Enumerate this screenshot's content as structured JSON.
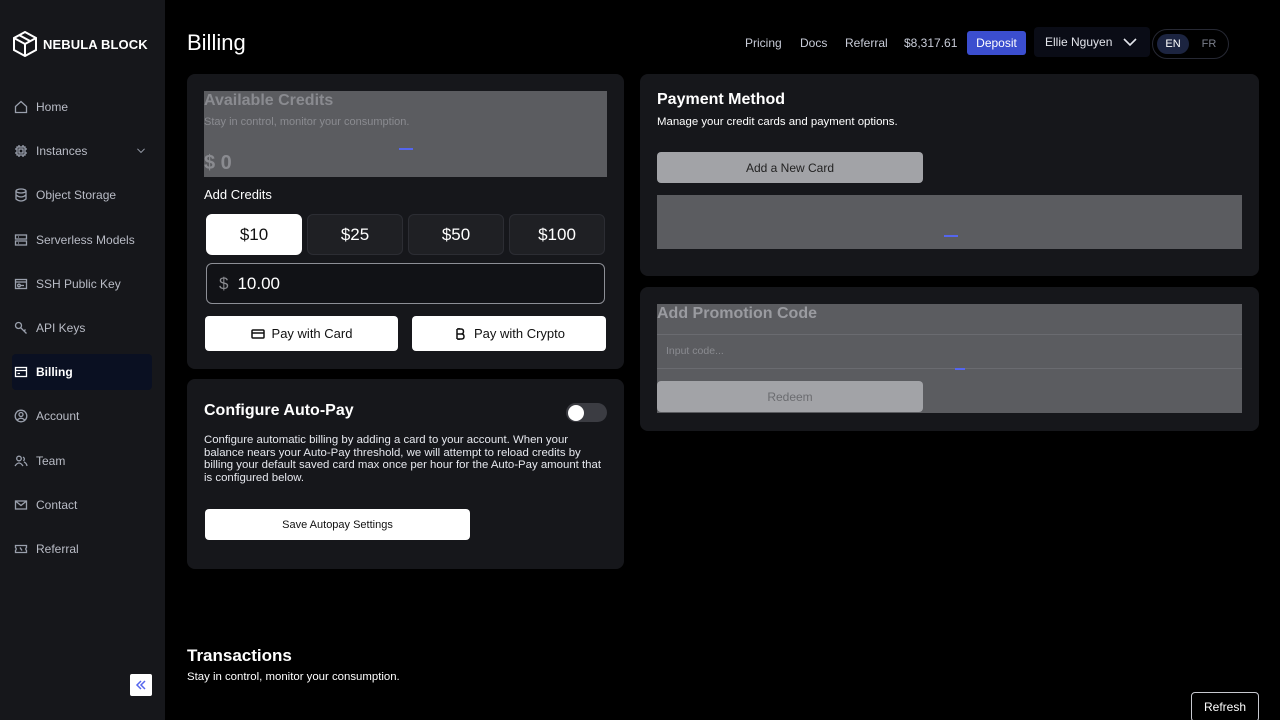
{
  "brand": {
    "name": "NEBULA BLOCK"
  },
  "sidebar": {
    "items": [
      {
        "label": "Home",
        "icon": "home-icon"
      },
      {
        "label": "Instances",
        "icon": "cpu-icon"
      },
      {
        "label": "Object Storage",
        "icon": "database-icon"
      },
      {
        "label": "Serverless Models",
        "icon": "server-icon"
      },
      {
        "label": "SSH Public Key",
        "icon": "key-box-icon"
      },
      {
        "label": "API Keys",
        "icon": "key-icon"
      },
      {
        "label": "Billing",
        "icon": "billing-icon"
      },
      {
        "label": "Account",
        "icon": "user-circle-icon"
      },
      {
        "label": "Team",
        "icon": "team-icon"
      },
      {
        "label": "Contact",
        "icon": "mail-icon"
      },
      {
        "label": "Referral",
        "icon": "ticket-icon"
      }
    ],
    "active": "Billing"
  },
  "header": {
    "title": "Billing",
    "links": [
      "Pricing",
      "Docs",
      "Referral"
    ],
    "balance": "$8,317.61",
    "deposit_label": "Deposit",
    "user_name": "Ellie Nguyen",
    "languages": [
      "EN",
      "FR"
    ],
    "active_language": "EN"
  },
  "credits": {
    "title": "Available Credits",
    "subtitle": "Stay in control, monitor your consumption.",
    "amount": "$ 0",
    "add_label": "Add Credits",
    "presets": [
      "$10",
      "$25",
      "$50",
      "$100"
    ],
    "selected_preset": "$10",
    "currency_symbol": "$",
    "input_value": "10.00",
    "pay_card_label": "Pay with Card",
    "pay_crypto_label": "Pay with Crypto"
  },
  "autopay": {
    "title": "Configure Auto-Pay",
    "enabled": false,
    "description": "Configure automatic billing by adding a card to your account. When your balance nears your Auto-Pay threshold, we will attempt to reload credits by billing your default saved card max once per hour for the Auto-Pay amount that is configured below.",
    "save_label": "Save Autopay Settings"
  },
  "payment": {
    "title": "Payment Method",
    "subtitle": "Manage your credit cards and payment options.",
    "add_card_label": "Add a New Card"
  },
  "promo": {
    "title": "Add Promotion Code",
    "placeholder": "Input code...",
    "redeem_label": "Redeem"
  },
  "transactions": {
    "title": "Transactions",
    "subtitle": "Stay in control, monitor your consumption.",
    "refresh_label": "Refresh"
  },
  "colors": {
    "accent": "#3b4ecf",
    "background": "#000000",
    "card": "#16171b"
  }
}
